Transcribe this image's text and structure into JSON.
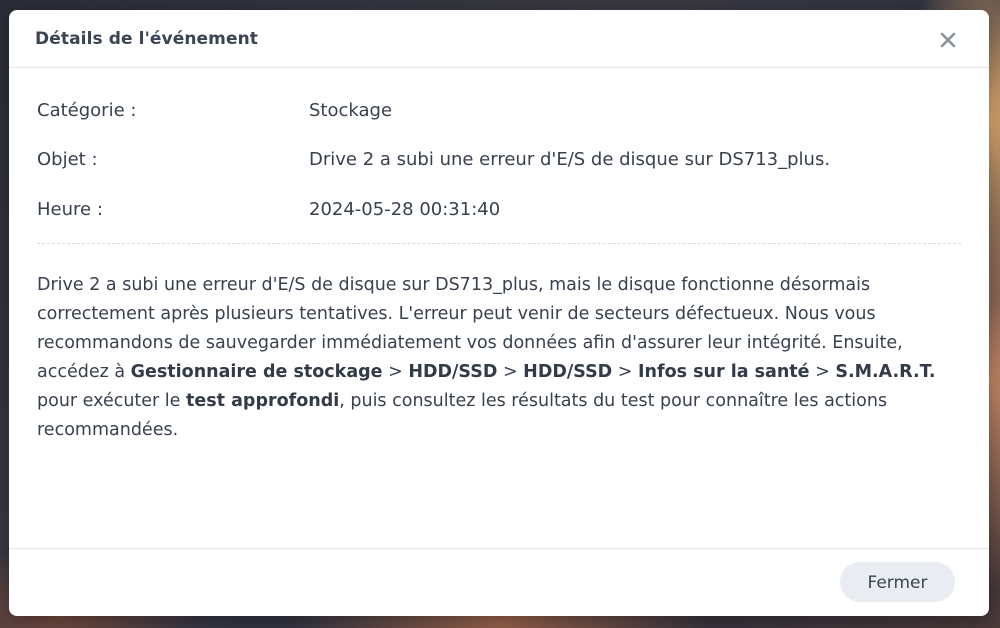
{
  "dialog": {
    "title": "Détails de l'événement",
    "close_icon": "close-icon",
    "fields": [
      {
        "label": "Catégorie :",
        "value": "Stockage"
      },
      {
        "label": "Objet :",
        "value": "Drive 2 a subi une erreur d'E/S de disque sur DS713_plus."
      },
      {
        "label": "Heure :",
        "value": "2024-05-28 00:31:40"
      }
    ],
    "description": {
      "part1": "Drive 2 a subi une erreur d'E/S de disque sur DS713_plus, mais le disque fonctionne désormais correctement après plusieurs tentatives. L'erreur peut venir de secteurs défectueux. Nous vous recommandons de sauvegarder immédiatement vos données afin d'assurer leur intégrité. Ensuite, accédez à ",
      "bold1": "Gestionnaire de stockage",
      "sep1": " > ",
      "bold2": "HDD/SSD",
      "sep2": " > ",
      "bold3": "HDD/SSD",
      "sep3": " > ",
      "bold4": "Infos sur la santé",
      "sep4": " > ",
      "bold5": "S.M.A.R.T.",
      "part2": " pour exécuter le ",
      "bold6": "test approfondi",
      "part3": ", puis consultez les résultats du test pour connaître les actions recommandées."
    },
    "footer": {
      "close_label": "Fermer"
    }
  }
}
